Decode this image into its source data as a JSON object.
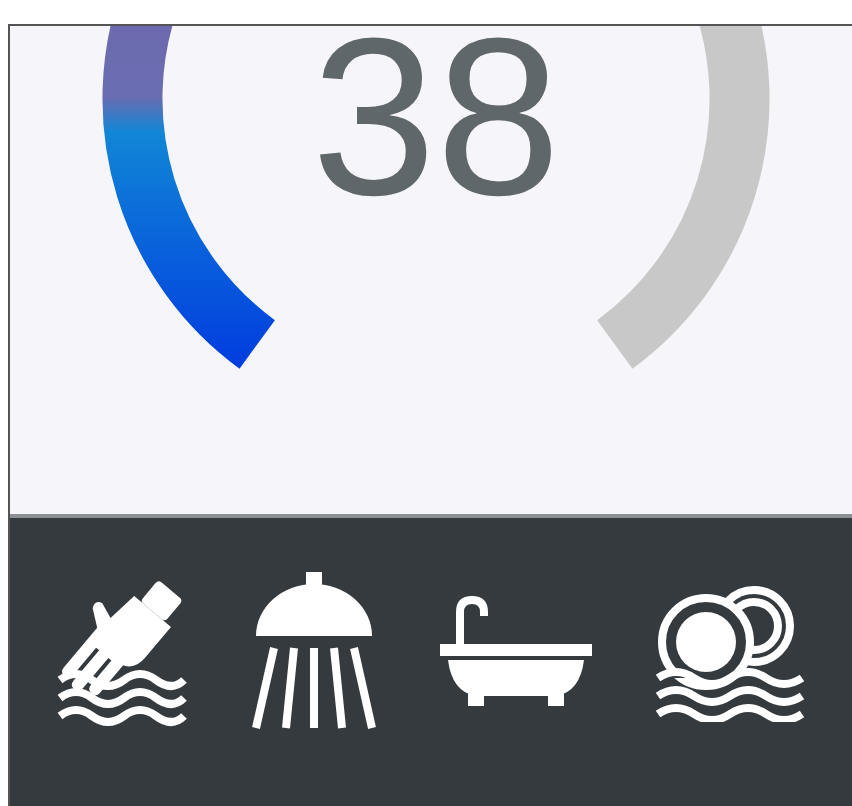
{
  "gauge": {
    "reading": "38"
  }
}
